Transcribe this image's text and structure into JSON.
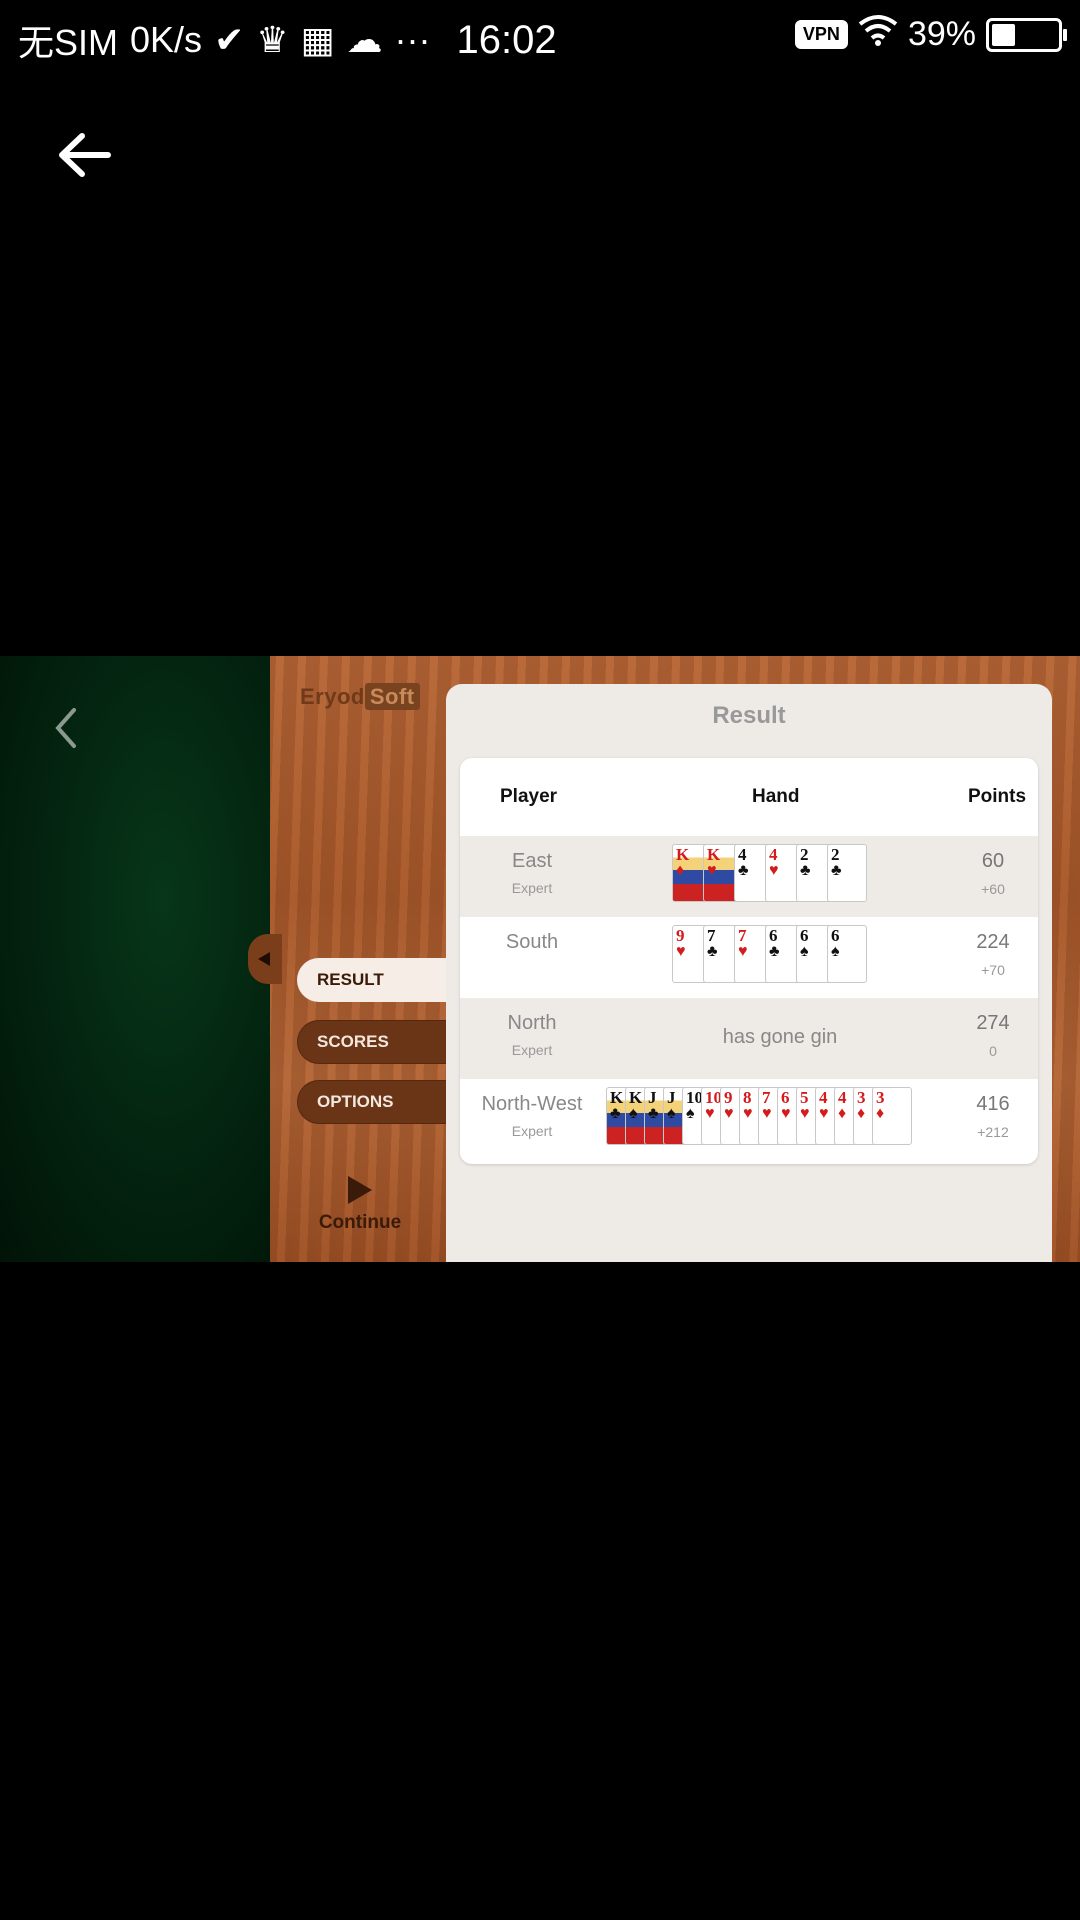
{
  "status_bar": {
    "carrier": "无SIM",
    "net_speed": "0K/s",
    "time": "16:02",
    "vpn": "VPN",
    "battery": "39%",
    "battery_level": 0.39
  },
  "game": {
    "brand_prefix": "Eryod",
    "brand_suffix": "Soft",
    "menu": {
      "result": "RESULT",
      "scores": "SCORES",
      "options": "OPTIONS"
    },
    "continue_label": "Continue",
    "result_panel": {
      "title": "Result",
      "headers": {
        "player": "Player",
        "hand": "Hand",
        "points": "Points"
      },
      "rows": [
        {
          "player": "East",
          "level": "Expert",
          "points": "60",
          "delta": "+60",
          "cards": [
            {
              "rank": "K",
              "suit": "♦",
              "color": "red",
              "face": true
            },
            {
              "rank": "K",
              "suit": "♥",
              "color": "red",
              "face": true
            },
            {
              "rank": "4",
              "suit": "♣",
              "color": "blk"
            },
            {
              "rank": "4",
              "suit": "♥",
              "color": "red"
            },
            {
              "rank": "2",
              "suit": "♣",
              "color": "blk"
            },
            {
              "rank": "2",
              "suit": "♣",
              "color": "blk"
            }
          ]
        },
        {
          "player": "South",
          "level": "",
          "points": "224",
          "delta": "+70",
          "cards": [
            {
              "rank": "9",
              "suit": "♥",
              "color": "red"
            },
            {
              "rank": "7",
              "suit": "♣",
              "color": "blk"
            },
            {
              "rank": "7",
              "suit": "♥",
              "color": "red"
            },
            {
              "rank": "6",
              "suit": "♣",
              "color": "blk"
            },
            {
              "rank": "6",
              "suit": "♠",
              "color": "blk"
            },
            {
              "rank": "6",
              "suit": "♠",
              "color": "blk"
            }
          ]
        },
        {
          "player": "North",
          "level": "Expert",
          "points": "274",
          "delta": "0",
          "hand_text": "has gone gin"
        },
        {
          "player": "North-West",
          "level": "Expert",
          "points": "416",
          "delta": "+212",
          "cards": [
            {
              "rank": "K",
              "suit": "♣",
              "color": "blk",
              "face": true
            },
            {
              "rank": "K",
              "suit": "♠",
              "color": "blk",
              "face": true
            },
            {
              "rank": "J",
              "suit": "♣",
              "color": "blk",
              "face": true
            },
            {
              "rank": "J",
              "suit": "♠",
              "color": "blk",
              "face": true
            },
            {
              "rank": "10",
              "suit": "♠",
              "color": "blk"
            },
            {
              "rank": "10",
              "suit": "♥",
              "color": "red"
            },
            {
              "rank": "9",
              "suit": "♥",
              "color": "red"
            },
            {
              "rank": "8",
              "suit": "♥",
              "color": "red"
            },
            {
              "rank": "7",
              "suit": "♥",
              "color": "red"
            },
            {
              "rank": "6",
              "suit": "♥",
              "color": "red"
            },
            {
              "rank": "5",
              "suit": "♥",
              "color": "red"
            },
            {
              "rank": "4",
              "suit": "♥",
              "color": "red"
            },
            {
              "rank": "4",
              "suit": "♦",
              "color": "red"
            },
            {
              "rank": "3",
              "suit": "♦",
              "color": "red"
            },
            {
              "rank": "3",
              "suit": "♦",
              "color": "red"
            }
          ]
        }
      ]
    }
  }
}
